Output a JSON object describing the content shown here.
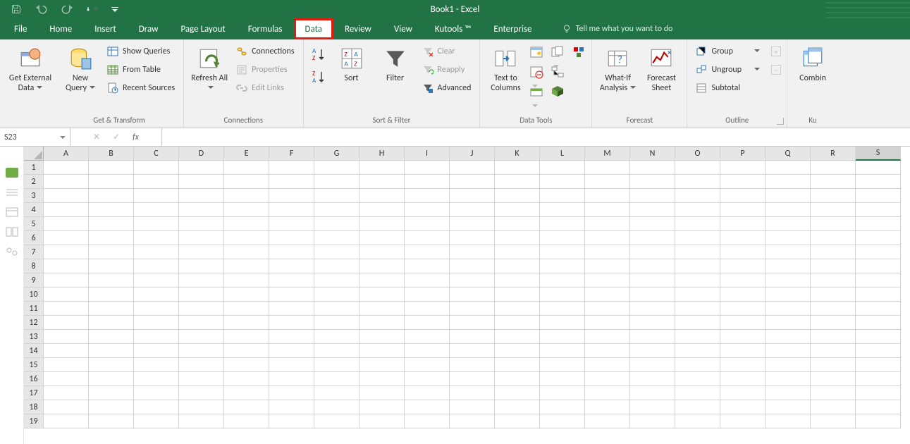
{
  "title": "Book1 - Excel",
  "qat": {
    "touch_icon": "touch-mode"
  },
  "tabs": [
    {
      "label": "File"
    },
    {
      "label": "Home"
    },
    {
      "label": "Insert"
    },
    {
      "label": "Draw"
    },
    {
      "label": "Page Layout"
    },
    {
      "label": "Formulas"
    },
    {
      "label": "Data",
      "active": true,
      "highlight": true
    },
    {
      "label": "Review"
    },
    {
      "label": "View"
    },
    {
      "label": "Kutools ™"
    },
    {
      "label": "Enterprise"
    }
  ],
  "tellme_placeholder": "Tell me what you want to do",
  "ribbon": {
    "get_transform": {
      "caption": "Get & Transform",
      "external": "Get External Data",
      "newquery": "New Query",
      "show_queries": "Show Queries",
      "from_table": "From Table",
      "recent": "Recent Sources"
    },
    "connections": {
      "caption": "Connections",
      "refresh": "Refresh All",
      "connections": "Connections",
      "properties": "Properties",
      "editlinks": "Edit Links"
    },
    "sortfilter": {
      "caption": "Sort & Filter",
      "sort": "Sort",
      "filter": "Filter",
      "clear": "Clear",
      "reapply": "Reapply",
      "advanced": "Advanced"
    },
    "datatools": {
      "caption": "Data Tools",
      "ttc": "Text to Columns"
    },
    "forecast": {
      "caption": "Forecast",
      "whatif": "What-If Analysis",
      "sheet": "Forecast Sheet"
    },
    "outline": {
      "caption": "Outline",
      "group": "Group",
      "ungroup": "Ungroup",
      "subtotal": "Subtotal"
    },
    "ku": {
      "caption": "Ku",
      "combine": "Combin"
    }
  },
  "formula_bar": {
    "namebox": "S23",
    "fx": "fx"
  },
  "columns": [
    "A",
    "B",
    "C",
    "D",
    "E",
    "F",
    "G",
    "H",
    "I",
    "J",
    "K",
    "L",
    "M",
    "N",
    "O",
    "P",
    "Q",
    "R",
    "S"
  ],
  "selected_col": "S",
  "rows": 19
}
